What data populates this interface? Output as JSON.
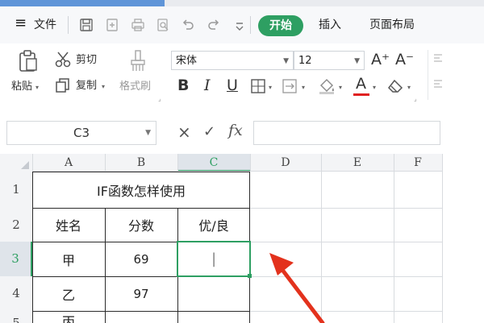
{
  "menu": {
    "hamburger_label": "≡",
    "file_label": "文件",
    "tabs": [
      {
        "label": "开始",
        "active": true
      },
      {
        "label": "插入",
        "active": false
      },
      {
        "label": "页面布局",
        "active": false
      }
    ],
    "quick_access_icons": [
      "save-icon",
      "export-icon",
      "print-icon",
      "print-preview-icon",
      "undo-icon",
      "redo-icon",
      "customize-dropdown-icon"
    ]
  },
  "ribbon": {
    "paste_label": "粘贴",
    "cut_label": "剪切",
    "copy_label": "复制",
    "format_painter_label": "格式刷",
    "font_name": "宋体",
    "font_size": "12",
    "bold_glyph": "B",
    "italic_glyph": "I",
    "underline_glyph": "U",
    "font_color_glyph": "A",
    "increase_font_glyph": "A⁺",
    "decrease_font_glyph": "A⁻",
    "accent_color": "#2e9f62",
    "font_color": "#e02020"
  },
  "formula_bar": {
    "name_box": "C3",
    "cancel_glyph": "×",
    "confirm_glyph": "✓",
    "fx_label": "fx",
    "formula": ""
  },
  "sheet": {
    "col_headers": [
      "A",
      "B",
      "C",
      "D",
      "E",
      "F"
    ],
    "row_headers": [
      "1",
      "2",
      "3",
      "4",
      "5"
    ],
    "selected_cell": "C3",
    "title": "IF函数怎样使用",
    "header_row": [
      "姓名",
      "分数",
      "优/良"
    ],
    "rows": [
      [
        "甲",
        "69",
        "|"
      ],
      [
        "乙",
        "97",
        ""
      ],
      [
        "丙",
        "",
        ""
      ]
    ]
  },
  "annotation": {
    "arrow_color": "#e3321d"
  }
}
